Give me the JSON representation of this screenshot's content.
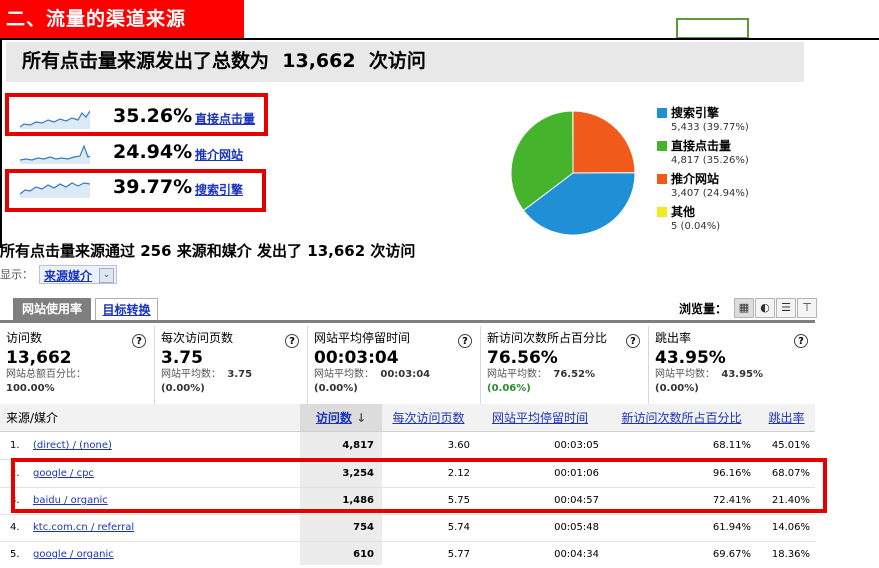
{
  "section_title": "二、流量的渠道来源",
  "summary_header": {
    "prefix": "所有点击量来源发出了总数为",
    "total": "13,662",
    "suffix": "次访问"
  },
  "sources": [
    {
      "percent": "35.26%",
      "label": "直接点击量",
      "highlighted": true
    },
    {
      "percent": "24.94%",
      "label": "推介网站",
      "highlighted": false
    },
    {
      "percent": "39.77%",
      "label": "搜索引擎",
      "highlighted": true
    }
  ],
  "chart_data": {
    "type": "pie",
    "slices": [
      {
        "name": "搜索引擎",
        "value": 5433,
        "value_label": "5,433 (39.77%)",
        "color": "#1f8fd6"
      },
      {
        "name": "直接点击量",
        "value": 4817,
        "value_label": "4,817 (35.26%)",
        "color": "#46b32d"
      },
      {
        "name": "推介网站",
        "value": 3407,
        "value_label": "3,407 (24.94%)",
        "color": "#f05a1a"
      },
      {
        "name": "其他",
        "value": 5,
        "value_label": "5 (0.04%)",
        "color": "#f2ea1c"
      }
    ],
    "legend_position": "right"
  },
  "summary_line": {
    "prefix": "所有点击量来源通过",
    "count": "256",
    "middle": "来源和媒介 发出了",
    "visits": "13,662",
    "suffix": "次访问"
  },
  "show": {
    "label": "显示：",
    "dropdown_value": "来源媒介",
    "arrow": "⌄"
  },
  "tabs": [
    {
      "label": "网站使用率",
      "active": true
    },
    {
      "label": "目标转换",
      "active": false
    }
  ],
  "view": {
    "label": "浏览量：",
    "buttons": [
      "▦",
      "◐",
      "☰",
      "⊤"
    ]
  },
  "metrics": [
    {
      "name": "访问数",
      "value": "13,662",
      "sub_label": "网站总额百分比：",
      "sub_value": "",
      "sub2": "100.00%"
    },
    {
      "name": "每次访问页数",
      "value": "3.75",
      "sub_label": "网站平均数：",
      "sub_value": "3.75",
      "sub2": "(0.00%)"
    },
    {
      "name": "网站平均停留时间",
      "value": "00:03:04",
      "sub_label": "网站平均数：",
      "sub_value": "00:03:04",
      "sub2": "(0.00%)"
    },
    {
      "name": "新访问次数所占百分比",
      "value": "76.56%",
      "sub_label": "网站平均数：",
      "sub_value": "76.52%",
      "sub2": "(0.06%)",
      "sub2_color": "#2e8b2e"
    },
    {
      "name": "跳出率",
      "value": "43.95%",
      "sub_label": "网站平均数：",
      "sub_value": "43.95%",
      "sub2": "(0.00%)"
    }
  ],
  "table": {
    "headers": [
      "来源/媒介",
      "访问数",
      "每次访问页数",
      "网站平均停留时间",
      "新访问次数所占百分比",
      "跳出率"
    ],
    "sort_arrow": "↓",
    "rows": [
      {
        "index": "1.",
        "source": "(direct) / (none)",
        "visits": "4,817",
        "pages": "3.60",
        "time": "00:03:05",
        "new": "68.11%",
        "bounce": "45.01%",
        "highlighted": false
      },
      {
        "index": "2.",
        "source": "google / cpc",
        "visits": "3,254",
        "pages": "2.12",
        "time": "00:01:06",
        "new": "96.16%",
        "bounce": "68.07%",
        "highlighted": true
      },
      {
        "index": "3.",
        "source": "baidu / organic",
        "visits": "1,486",
        "pages": "5.75",
        "time": "00:04:57",
        "new": "72.41%",
        "bounce": "21.40%",
        "highlighted": true
      },
      {
        "index": "4.",
        "source": "ktc.com.cn / referral",
        "visits": "754",
        "pages": "5.74",
        "time": "00:05:48",
        "new": "61.94%",
        "bounce": "14.06%",
        "highlighted": false
      },
      {
        "index": "5.",
        "source": "google / organic",
        "visits": "610",
        "pages": "5.77",
        "time": "00:04:34",
        "new": "69.67%",
        "bounce": "18.36%",
        "highlighted": false
      }
    ]
  },
  "help_glyph": "?"
}
